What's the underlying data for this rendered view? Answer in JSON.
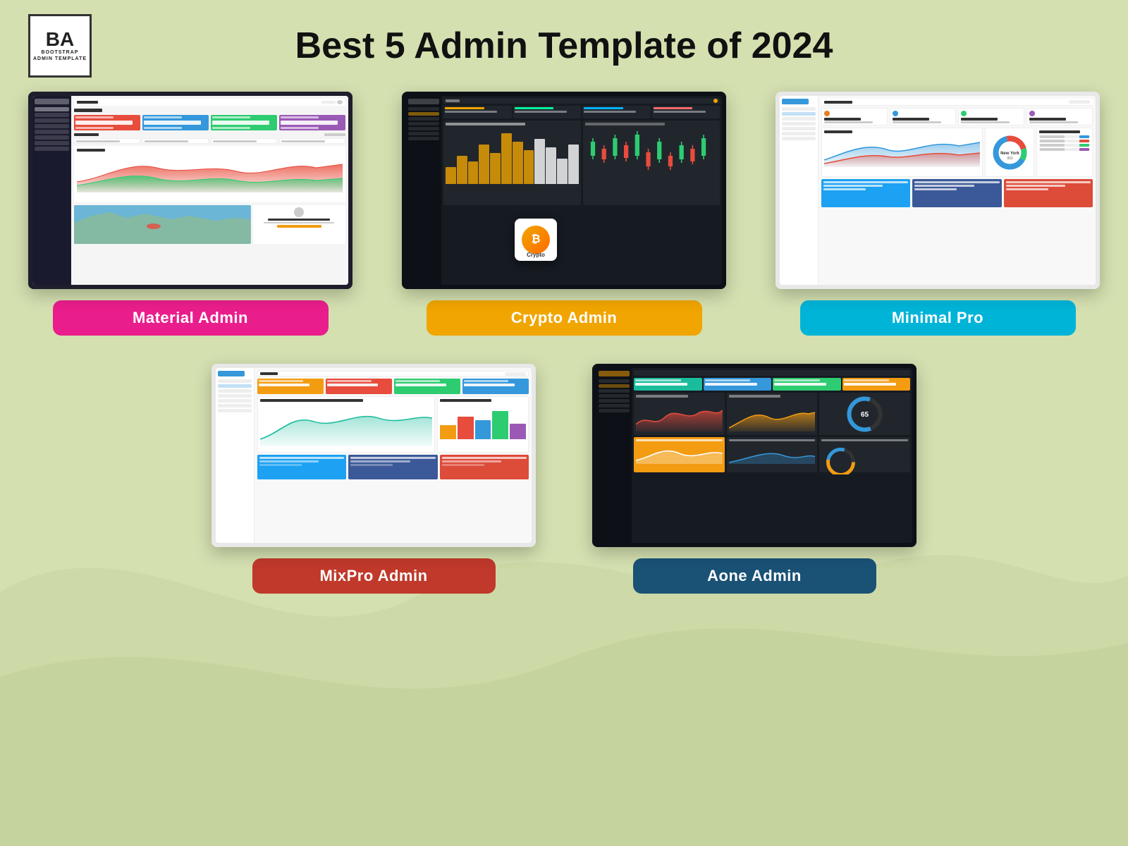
{
  "page": {
    "title": "Best 5 Admin Template of 2024",
    "background_color": "#d4e0b0"
  },
  "logo": {
    "letters": "BA",
    "line1": "BOOTSTRAP",
    "line2": "ADMIN TEMPLATE"
  },
  "templates": [
    {
      "id": "material-admin",
      "label": "Material  Admin",
      "badge_color": "#e91e8c",
      "position": "top-left"
    },
    {
      "id": "crypto-admin",
      "label": "Crypto Admin",
      "badge_color": "#f0a500",
      "position": "top-center"
    },
    {
      "id": "minimal-pro",
      "label": "Minimal Pro",
      "badge_color": "#00b4d8",
      "position": "top-right"
    },
    {
      "id": "mixpro-admin",
      "label": "MixPro Admin",
      "badge_color": "#c0392b",
      "position": "bottom-left"
    },
    {
      "id": "aone-admin",
      "label": "Aone  Admin",
      "badge_color": "#1a5276",
      "position": "bottom-right"
    }
  ]
}
